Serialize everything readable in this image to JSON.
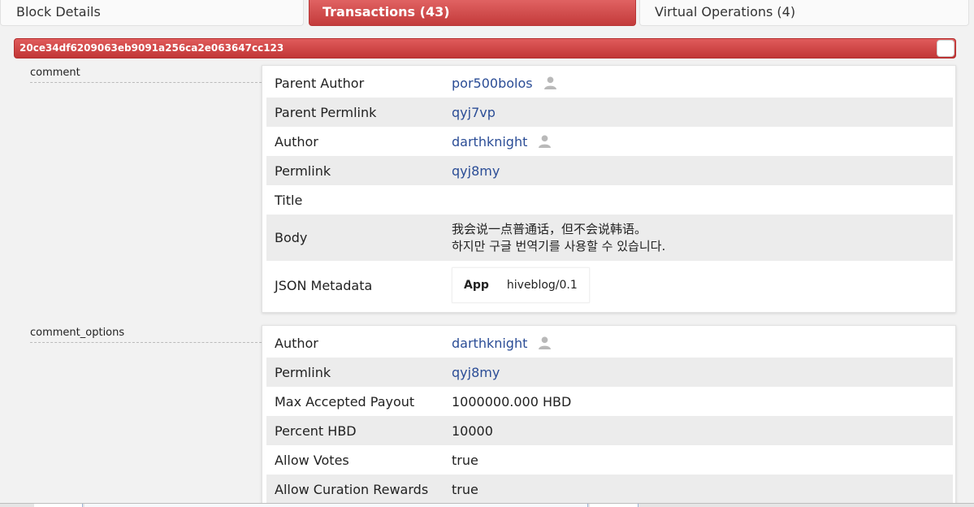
{
  "tabs": [
    {
      "label": "Block Details"
    },
    {
      "label": "Transactions (43)"
    },
    {
      "label": "Virtual Operations (4)"
    }
  ],
  "transaction": {
    "id": "20ce34df6209063eb9091a256ca2e063647cc123"
  },
  "operations": [
    {
      "type": "comment",
      "rows": [
        {
          "label": "Parent Author",
          "value": "por500bolos"
        },
        {
          "label": "Parent Permlink",
          "value": "qyj7vp"
        },
        {
          "label": "Author",
          "value": "darthknight"
        },
        {
          "label": "Permlink",
          "value": "qyj8my"
        },
        {
          "label": "Title",
          "value": ""
        },
        {
          "label": "Body",
          "line1": "我会说一点普通话，但不会说韩语。",
          "line2": "하지만 구글 번역기를 사용할 수 있습니다."
        },
        {
          "label": "JSON Metadata",
          "key": "App",
          "value": "hiveblog/0.1"
        }
      ]
    },
    {
      "type": "comment_options",
      "rows": [
        {
          "label": "Author",
          "value": "darthknight"
        },
        {
          "label": "Permlink",
          "value": "qyj8my"
        },
        {
          "label": "Max Accepted Payout",
          "value": "1000000.000 HBD"
        },
        {
          "label": "Percent HBD",
          "value": "10000"
        },
        {
          "label": "Allow Votes",
          "value": "true"
        },
        {
          "label": "Allow Curation Rewards",
          "value": "true"
        }
      ]
    }
  ],
  "icons": {
    "user": "user-icon"
  },
  "colors": {
    "accent": "#c94444",
    "link": "#2b4d96",
    "row_shade": "#ececec"
  }
}
